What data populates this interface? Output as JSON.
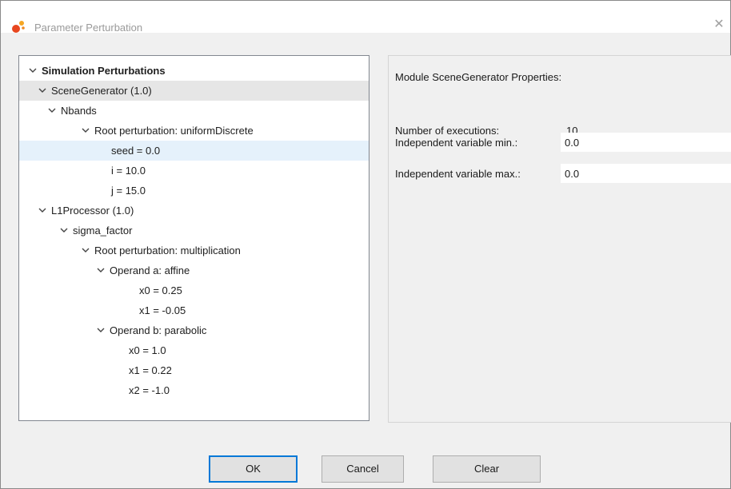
{
  "window": {
    "title": "Parameter Perturbation",
    "app_icon": "orange-dots-icon",
    "close_icon": "close-icon"
  },
  "tree": {
    "root_label": "Simulation Perturbations",
    "items": [
      {
        "label": "SceneGenerator (1.0)"
      },
      {
        "label": "Nbands"
      },
      {
        "label": "Root perturbation: uniformDiscrete"
      },
      {
        "label": "seed = 0.0"
      },
      {
        "label": "i = 10.0"
      },
      {
        "label": "j = 15.0"
      },
      {
        "label": "L1Processor (1.0)"
      },
      {
        "label": "sigma_factor"
      },
      {
        "label": "Root perturbation: multiplication"
      },
      {
        "label": "Operand a: affine"
      },
      {
        "label": "x0 = 0.25"
      },
      {
        "label": "x1 = -0.05"
      },
      {
        "label": "Operand b: parabolic"
      },
      {
        "label": "x0 = 1.0"
      },
      {
        "label": "x1 = 0.22"
      },
      {
        "label": "x2 = -1.0"
      }
    ]
  },
  "properties": {
    "header": "Module SceneGenerator Properties:",
    "executions_label": "Number of executions:",
    "executions_value": "10",
    "min_label": "Independent variable min.:",
    "min_value": "0.0",
    "max_label": "Independent variable max.:",
    "max_value": "0.0"
  },
  "buttons": {
    "ok": "OK",
    "cancel": "Cancel",
    "clear": "Clear"
  },
  "colors": {
    "tree_hover_row": "#e6e6e6",
    "tree_selected_row": "#e5f1fb",
    "default_button_border": "#0078d7"
  }
}
